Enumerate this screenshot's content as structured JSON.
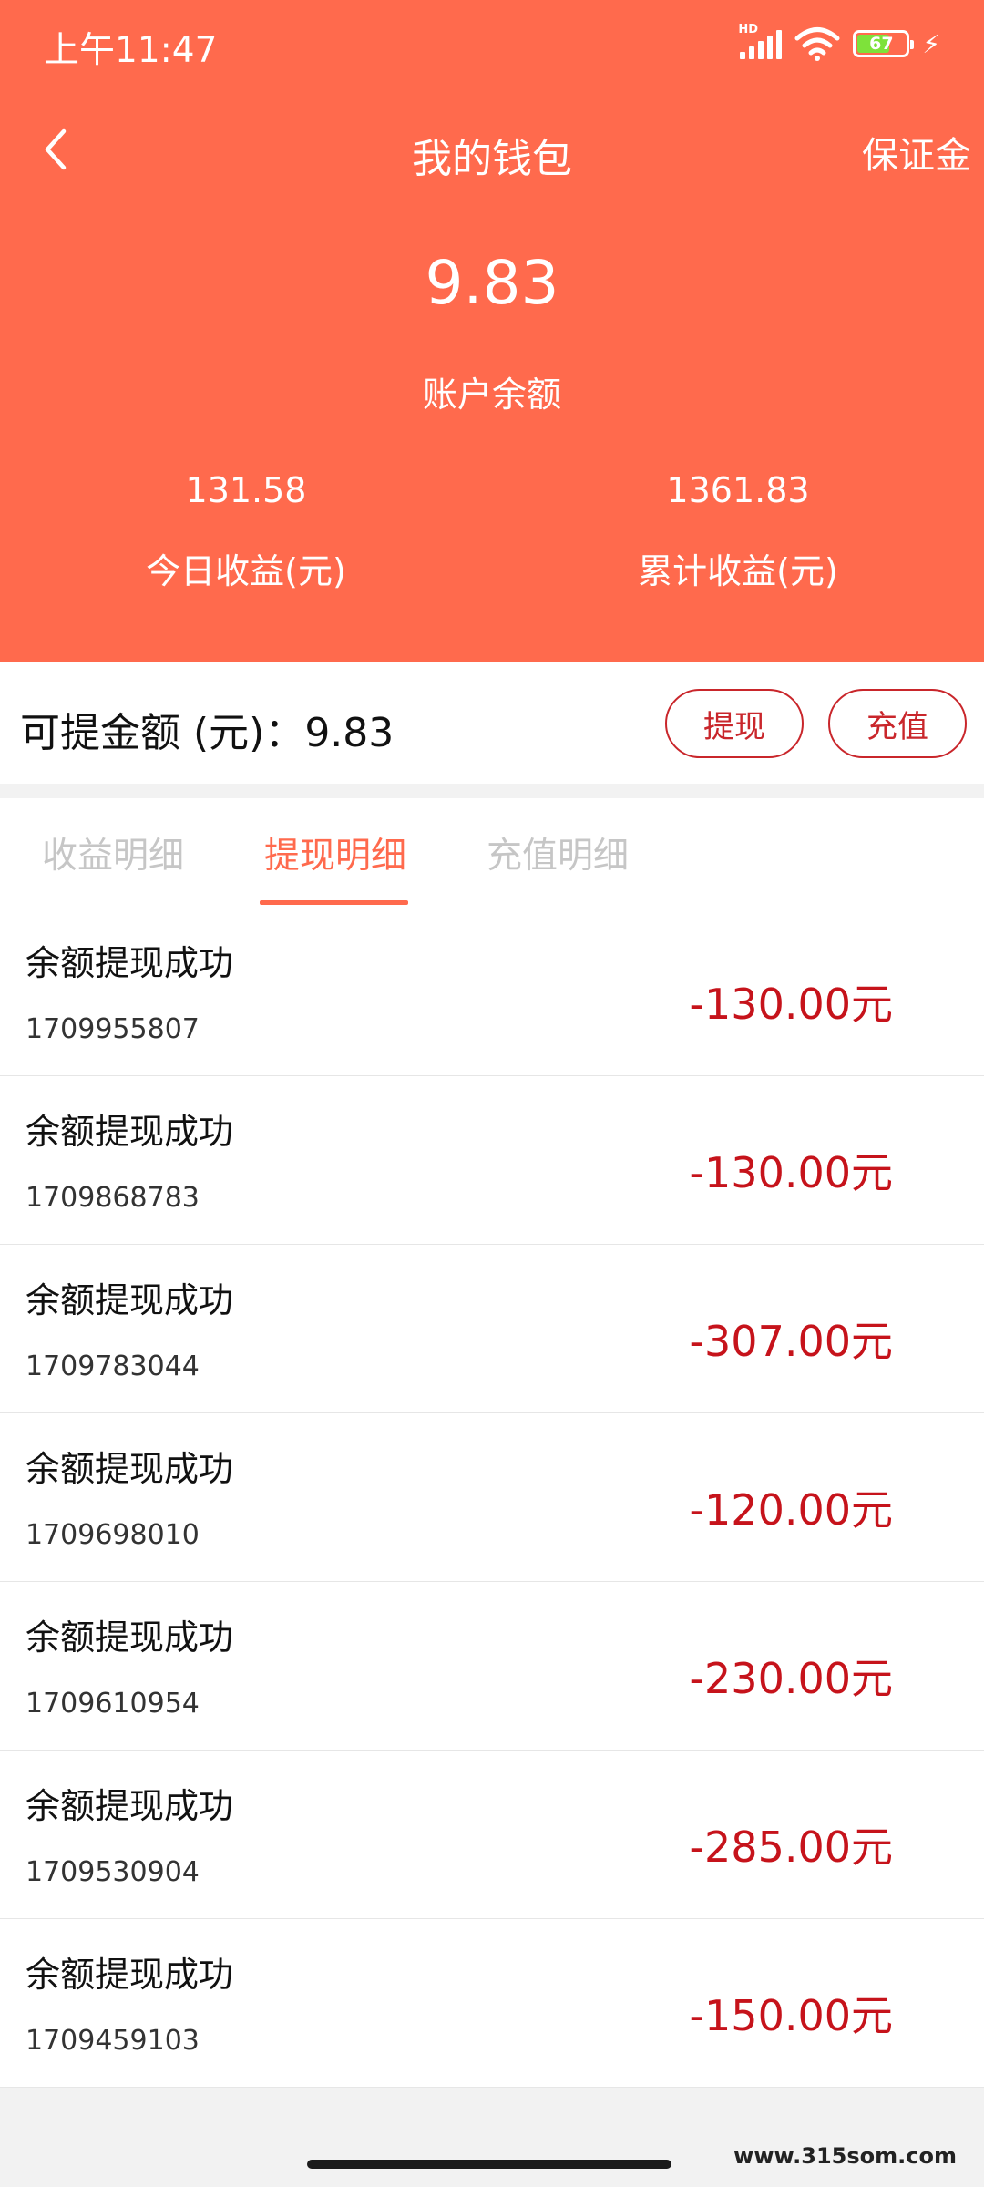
{
  "status_bar": {
    "time": "上午11:47",
    "hd_label": "HD",
    "battery_percent": "67",
    "battery_level": 0.67,
    "icons": [
      "signal-icon",
      "wifi-icon",
      "battery-icon",
      "charging-icon"
    ]
  },
  "header": {
    "title": "我的钱包",
    "right_link": "保证金",
    "back_icon": "back-arrow-icon"
  },
  "balance": {
    "value": "9.83",
    "label": "账户余额"
  },
  "stats": {
    "today_value": "131.58",
    "today_label": "今日收益(元)",
    "total_value": "1361.83",
    "total_label": "累计收益(元)"
  },
  "withdrawable": {
    "text": "可提金额 (元)：9.83",
    "withdraw_button": "提现",
    "recharge_button": "充值"
  },
  "tabs": [
    {
      "label": "收益明细",
      "active": false
    },
    {
      "label": "提现明细",
      "active": true
    },
    {
      "label": "充值明细",
      "active": false
    }
  ],
  "records": [
    {
      "title": "余额提现成功",
      "time": "1709955807",
      "amount": "-130.00元"
    },
    {
      "title": "余额提现成功",
      "time": "1709868783",
      "amount": "-130.00元"
    },
    {
      "title": "余额提现成功",
      "time": "1709783044",
      "amount": "-307.00元"
    },
    {
      "title": "余额提现成功",
      "time": "1709698010",
      "amount": "-120.00元"
    },
    {
      "title": "余额提现成功",
      "time": "1709610954",
      "amount": "-230.00元"
    },
    {
      "title": "余额提现成功",
      "time": "1709530904",
      "amount": "-285.00元"
    },
    {
      "title": "余额提现成功",
      "time": "1709459103",
      "amount": "-150.00元"
    }
  ],
  "watermark": "www.315som.com",
  "colors": {
    "brand": "#ff6a4d",
    "amount": "#c6131b",
    "button_border": "#c9262b",
    "tab_inactive": "#c6c6c6"
  }
}
